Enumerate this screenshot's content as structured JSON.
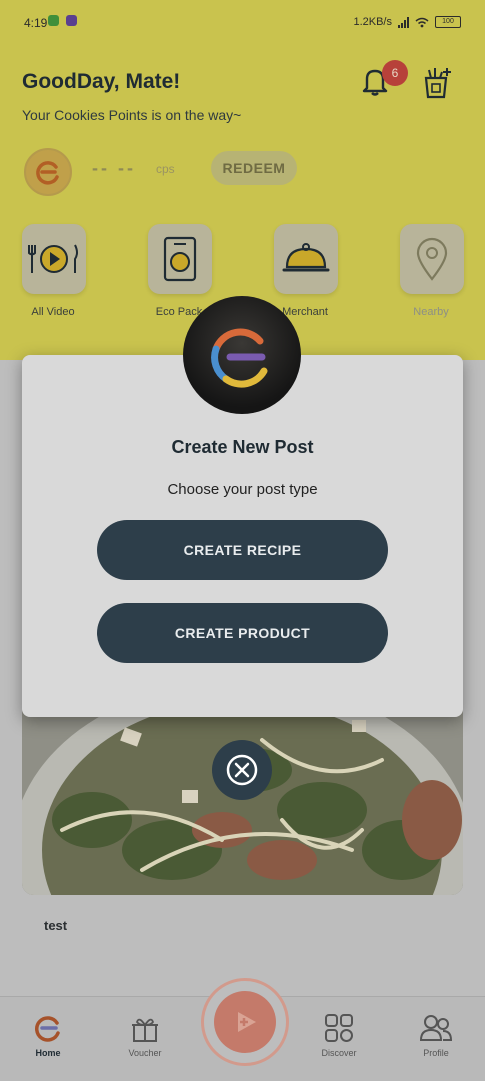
{
  "status_bar": {
    "time": "4:19",
    "speed": "1.2KB/s",
    "battery": "100"
  },
  "header": {
    "greeting": "GoodDay, Mate!",
    "subtext": "Your Cookies Points is on the way~",
    "notification_count": "6"
  },
  "points": {
    "value": "-- --",
    "unit": "cps",
    "redeem_label": "REDEEM"
  },
  "menu": [
    {
      "label": "All Video",
      "icon": "video-icon"
    },
    {
      "label": "Eco Pack",
      "icon": "eco-pack-icon"
    },
    {
      "label": "Merchant",
      "icon": "cloche-icon"
    },
    {
      "label": "Nearby",
      "icon": "location-pin-icon"
    }
  ],
  "feed": {
    "post_title": "test"
  },
  "modal": {
    "title": "Create New Post",
    "subtitle": "Choose your post type",
    "create_recipe_label": "CREATE RECIPE",
    "create_product_label": "CREATE PRODUCT"
  },
  "bottom_nav": {
    "items": [
      {
        "label": "Home",
        "icon": "home-logo-icon",
        "active": true
      },
      {
        "label": "Voucher",
        "icon": "gift-icon",
        "active": false
      },
      {
        "label": "Discover",
        "icon": "grid-icon",
        "active": false
      },
      {
        "label": "Profile",
        "icon": "people-icon",
        "active": false
      }
    ]
  },
  "colors": {
    "header_yellow": "#c9c34e",
    "primary_dark": "#2d3e4a",
    "badge_red": "#b7413a",
    "fab_coral": "#c47a6a"
  }
}
